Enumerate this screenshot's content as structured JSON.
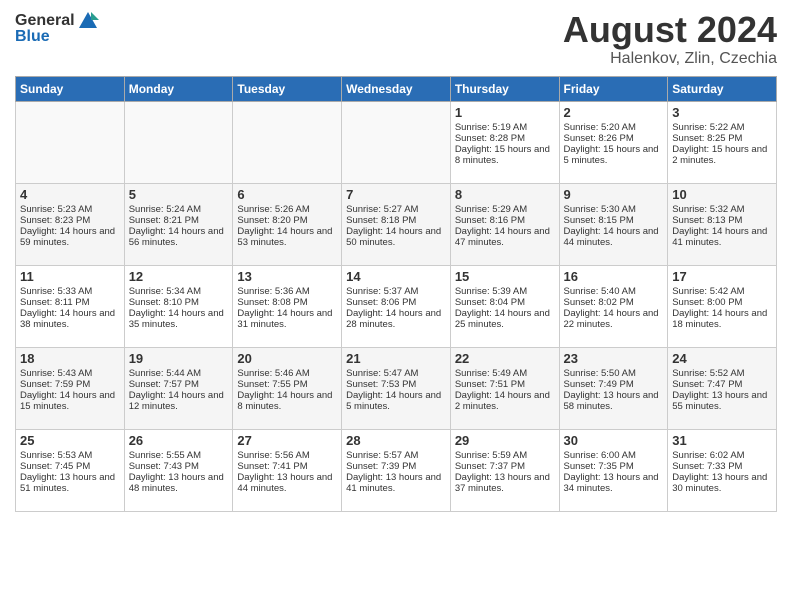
{
  "header": {
    "logo_general": "General",
    "logo_blue": "Blue",
    "month_year": "August 2024",
    "location": "Halenkov, Zlin, Czechia"
  },
  "days_of_week": [
    "Sunday",
    "Monday",
    "Tuesday",
    "Wednesday",
    "Thursday",
    "Friday",
    "Saturday"
  ],
  "weeks": [
    [
      {
        "day": "",
        "sunrise": "",
        "sunset": "",
        "daylight": ""
      },
      {
        "day": "",
        "sunrise": "",
        "sunset": "",
        "daylight": ""
      },
      {
        "day": "",
        "sunrise": "",
        "sunset": "",
        "daylight": ""
      },
      {
        "day": "",
        "sunrise": "",
        "sunset": "",
        "daylight": ""
      },
      {
        "day": "1",
        "sunrise": "Sunrise: 5:19 AM",
        "sunset": "Sunset: 8:28 PM",
        "daylight": "Daylight: 15 hours and 8 minutes."
      },
      {
        "day": "2",
        "sunrise": "Sunrise: 5:20 AM",
        "sunset": "Sunset: 8:26 PM",
        "daylight": "Daylight: 15 hours and 5 minutes."
      },
      {
        "day": "3",
        "sunrise": "Sunrise: 5:22 AM",
        "sunset": "Sunset: 8:25 PM",
        "daylight": "Daylight: 15 hours and 2 minutes."
      }
    ],
    [
      {
        "day": "4",
        "sunrise": "Sunrise: 5:23 AM",
        "sunset": "Sunset: 8:23 PM",
        "daylight": "Daylight: 14 hours and 59 minutes."
      },
      {
        "day": "5",
        "sunrise": "Sunrise: 5:24 AM",
        "sunset": "Sunset: 8:21 PM",
        "daylight": "Daylight: 14 hours and 56 minutes."
      },
      {
        "day": "6",
        "sunrise": "Sunrise: 5:26 AM",
        "sunset": "Sunset: 8:20 PM",
        "daylight": "Daylight: 14 hours and 53 minutes."
      },
      {
        "day": "7",
        "sunrise": "Sunrise: 5:27 AM",
        "sunset": "Sunset: 8:18 PM",
        "daylight": "Daylight: 14 hours and 50 minutes."
      },
      {
        "day": "8",
        "sunrise": "Sunrise: 5:29 AM",
        "sunset": "Sunset: 8:16 PM",
        "daylight": "Daylight: 14 hours and 47 minutes."
      },
      {
        "day": "9",
        "sunrise": "Sunrise: 5:30 AM",
        "sunset": "Sunset: 8:15 PM",
        "daylight": "Daylight: 14 hours and 44 minutes."
      },
      {
        "day": "10",
        "sunrise": "Sunrise: 5:32 AM",
        "sunset": "Sunset: 8:13 PM",
        "daylight": "Daylight: 14 hours and 41 minutes."
      }
    ],
    [
      {
        "day": "11",
        "sunrise": "Sunrise: 5:33 AM",
        "sunset": "Sunset: 8:11 PM",
        "daylight": "Daylight: 14 hours and 38 minutes."
      },
      {
        "day": "12",
        "sunrise": "Sunrise: 5:34 AM",
        "sunset": "Sunset: 8:10 PM",
        "daylight": "Daylight: 14 hours and 35 minutes."
      },
      {
        "day": "13",
        "sunrise": "Sunrise: 5:36 AM",
        "sunset": "Sunset: 8:08 PM",
        "daylight": "Daylight: 14 hours and 31 minutes."
      },
      {
        "day": "14",
        "sunrise": "Sunrise: 5:37 AM",
        "sunset": "Sunset: 8:06 PM",
        "daylight": "Daylight: 14 hours and 28 minutes."
      },
      {
        "day": "15",
        "sunrise": "Sunrise: 5:39 AM",
        "sunset": "Sunset: 8:04 PM",
        "daylight": "Daylight: 14 hours and 25 minutes."
      },
      {
        "day": "16",
        "sunrise": "Sunrise: 5:40 AM",
        "sunset": "Sunset: 8:02 PM",
        "daylight": "Daylight: 14 hours and 22 minutes."
      },
      {
        "day": "17",
        "sunrise": "Sunrise: 5:42 AM",
        "sunset": "Sunset: 8:00 PM",
        "daylight": "Daylight: 14 hours and 18 minutes."
      }
    ],
    [
      {
        "day": "18",
        "sunrise": "Sunrise: 5:43 AM",
        "sunset": "Sunset: 7:59 PM",
        "daylight": "Daylight: 14 hours and 15 minutes."
      },
      {
        "day": "19",
        "sunrise": "Sunrise: 5:44 AM",
        "sunset": "Sunset: 7:57 PM",
        "daylight": "Daylight: 14 hours and 12 minutes."
      },
      {
        "day": "20",
        "sunrise": "Sunrise: 5:46 AM",
        "sunset": "Sunset: 7:55 PM",
        "daylight": "Daylight: 14 hours and 8 minutes."
      },
      {
        "day": "21",
        "sunrise": "Sunrise: 5:47 AM",
        "sunset": "Sunset: 7:53 PM",
        "daylight": "Daylight: 14 hours and 5 minutes."
      },
      {
        "day": "22",
        "sunrise": "Sunrise: 5:49 AM",
        "sunset": "Sunset: 7:51 PM",
        "daylight": "Daylight: 14 hours and 2 minutes."
      },
      {
        "day": "23",
        "sunrise": "Sunrise: 5:50 AM",
        "sunset": "Sunset: 7:49 PM",
        "daylight": "Daylight: 13 hours and 58 minutes."
      },
      {
        "day": "24",
        "sunrise": "Sunrise: 5:52 AM",
        "sunset": "Sunset: 7:47 PM",
        "daylight": "Daylight: 13 hours and 55 minutes."
      }
    ],
    [
      {
        "day": "25",
        "sunrise": "Sunrise: 5:53 AM",
        "sunset": "Sunset: 7:45 PM",
        "daylight": "Daylight: 13 hours and 51 minutes."
      },
      {
        "day": "26",
        "sunrise": "Sunrise: 5:55 AM",
        "sunset": "Sunset: 7:43 PM",
        "daylight": "Daylight: 13 hours and 48 minutes."
      },
      {
        "day": "27",
        "sunrise": "Sunrise: 5:56 AM",
        "sunset": "Sunset: 7:41 PM",
        "daylight": "Daylight: 13 hours and 44 minutes."
      },
      {
        "day": "28",
        "sunrise": "Sunrise: 5:57 AM",
        "sunset": "Sunset: 7:39 PM",
        "daylight": "Daylight: 13 hours and 41 minutes."
      },
      {
        "day": "29",
        "sunrise": "Sunrise: 5:59 AM",
        "sunset": "Sunset: 7:37 PM",
        "daylight": "Daylight: 13 hours and 37 minutes."
      },
      {
        "day": "30",
        "sunrise": "Sunrise: 6:00 AM",
        "sunset": "Sunset: 7:35 PM",
        "daylight": "Daylight: 13 hours and 34 minutes."
      },
      {
        "day": "31",
        "sunrise": "Sunrise: 6:02 AM",
        "sunset": "Sunset: 7:33 PM",
        "daylight": "Daylight: 13 hours and 30 minutes."
      }
    ]
  ]
}
